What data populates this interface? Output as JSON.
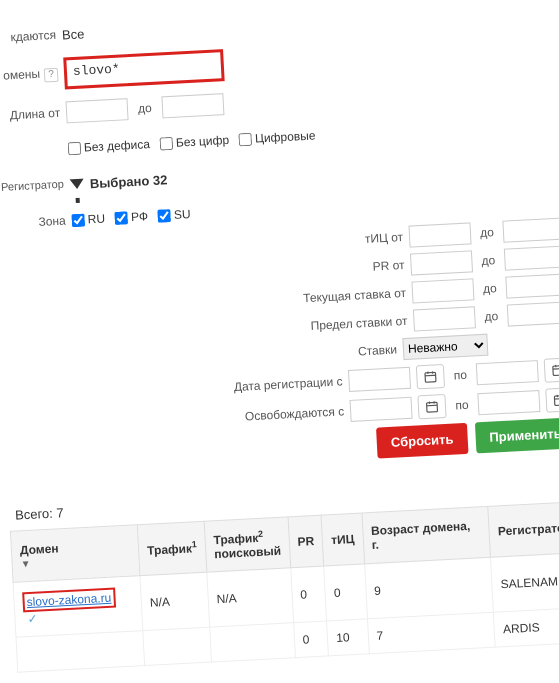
{
  "filters": {
    "released_label": "кдаются",
    "released_value": "Все",
    "domains_label": "омены",
    "domains_value": "slovo*",
    "length_label": "Длина от",
    "to": "до",
    "no_hyphen": "Без дефиса",
    "no_digits": "Без цифр",
    "digital": "Цифровые",
    "registrar_label": "Регистратор",
    "selected": "Выбрано 32",
    "zone_label": "Зона",
    "zones": {
      "ru": "RU",
      "rf": "РФ",
      "su": "SU"
    }
  },
  "right": {
    "tic_from": "тИЦ от",
    "pr_from": "PR от",
    "current_bid_from": "Текущая ставка от",
    "max_bid_from": "Предел ставки от",
    "bids_label": "Ставки",
    "bids_value": "Неважно",
    "reg_date_from": "Дата регистрации с",
    "release_from": "Освобождаются с",
    "po": "по",
    "to": "до"
  },
  "buttons": {
    "reset": "Сбросить",
    "apply": "Применить"
  },
  "total_label": "Всего: 7",
  "table": {
    "headers": {
      "domain": "Домен",
      "traffic": "Трафик",
      "traffic_search": "Трафик",
      "traffic_search_sub": "поисковый",
      "pr": "PR",
      "tic": "тИЦ",
      "age": "Возраст домена, г.",
      "registrar": "Регистратор"
    },
    "rows": [
      {
        "domain": "slovo-zakona.ru",
        "traffic": "N/A",
        "traffic_search": "N/A",
        "pr": "0",
        "tic": "0",
        "age": "9",
        "registrar": "SALENAM"
      },
      {
        "domain": "",
        "traffic": "",
        "traffic_search": "",
        "pr": "0",
        "tic": "10",
        "age": "7",
        "registrar": "ARDIS"
      }
    ]
  }
}
